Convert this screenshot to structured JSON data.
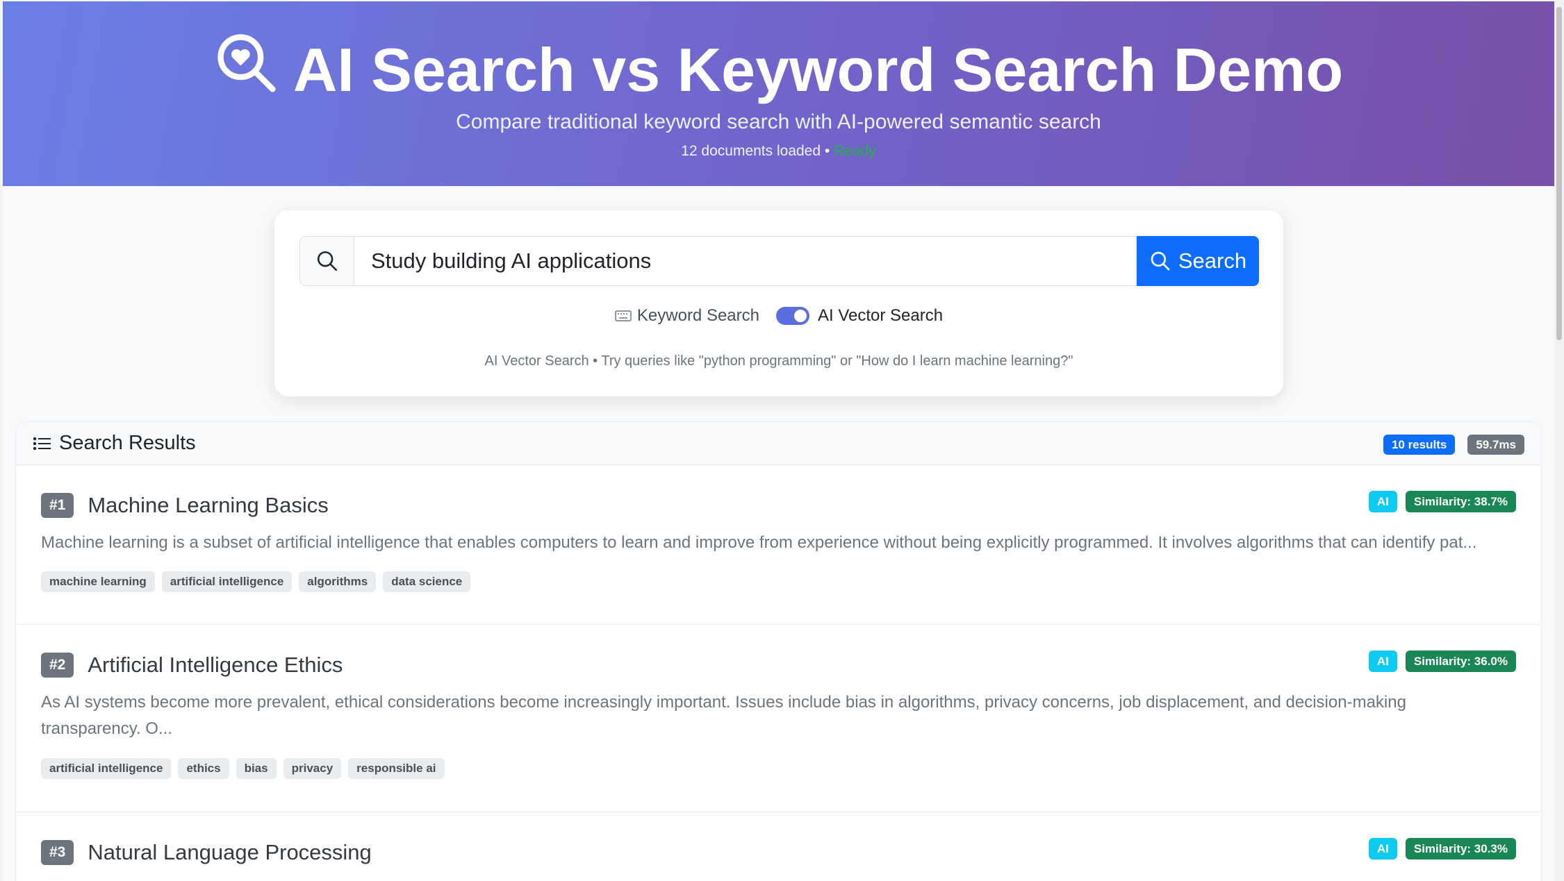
{
  "header": {
    "title": "AI Search vs Keyword Search Demo",
    "subtitle": "Compare traditional keyword search with AI-powered semantic search",
    "docs_loaded": "12 documents loaded •",
    "status": "Ready"
  },
  "search": {
    "query": "Study building AI applications",
    "button_label": "Search",
    "keyword_label": "Keyword Search",
    "ai_label": "AI Vector Search",
    "ai_enabled": true,
    "hint": "AI Vector Search • Try queries like \"python programming\" or \"How do I learn machine learning?\""
  },
  "results": {
    "title": "Search Results",
    "count": "10 results",
    "time": "59.7ms",
    "items": [
      {
        "rank": "#1",
        "title": "Machine Learning Basics",
        "type": "AI",
        "similarity": "Similarity: 38.7%",
        "description": "Machine learning is a subset of artificial intelligence that enables computers to learn and improve from experience without being explicitly programmed. It involves algorithms that can identify pat...",
        "tags": [
          "machine learning",
          "artificial intelligence",
          "algorithms",
          "data science"
        ]
      },
      {
        "rank": "#2",
        "title": "Artificial Intelligence Ethics",
        "type": "AI",
        "similarity": "Similarity: 36.0%",
        "description": "As AI systems become more prevalent, ethical considerations become increasingly important. Issues include bias in algorithms, privacy concerns, job displacement, and decision-making transparency. O...",
        "tags": [
          "artificial intelligence",
          "ethics",
          "bias",
          "privacy",
          "responsible ai"
        ]
      },
      {
        "rank": "#3",
        "title": "Natural Language Processing",
        "type": "AI",
        "similarity": "Similarity: 30.3%",
        "description": "",
        "tags": []
      }
    ]
  },
  "colors": {
    "primary": "#0d6efd",
    "success": "#198754",
    "info": "#0dcaf0",
    "ready": "#22b34c"
  }
}
